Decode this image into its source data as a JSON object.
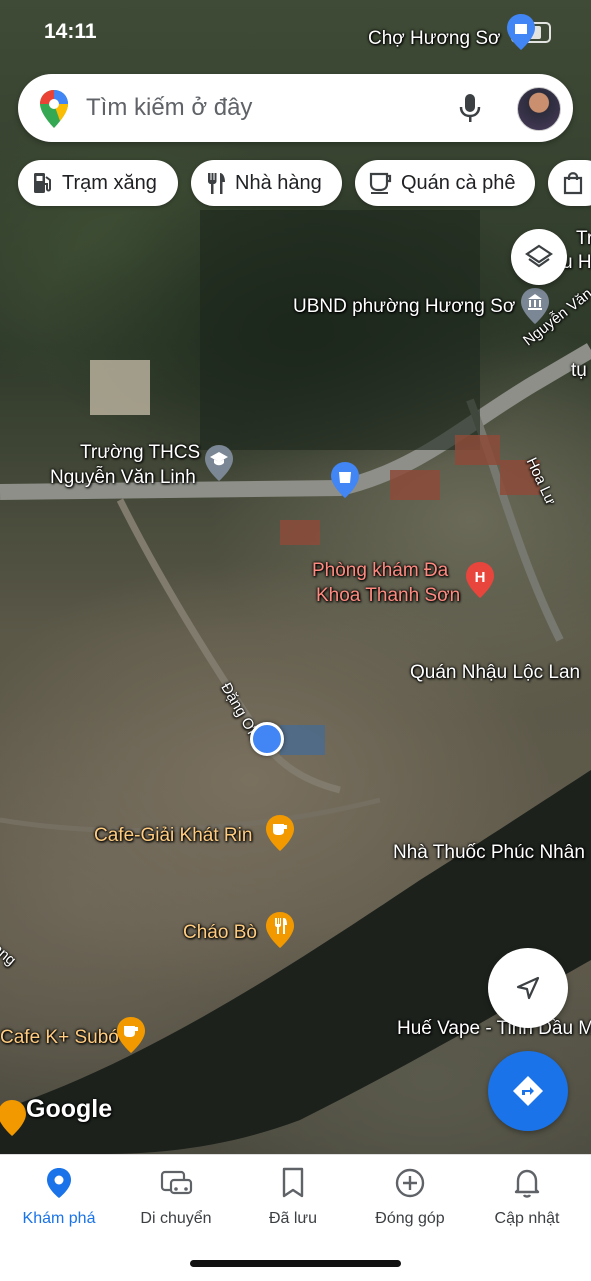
{
  "status": {
    "time": "14:11"
  },
  "search": {
    "placeholder": "Tìm kiếm ở đây"
  },
  "chips": [
    {
      "label": "Trạm xăng",
      "icon": "gas-station-icon"
    },
    {
      "label": "Nhà hàng",
      "icon": "restaurant-icon"
    },
    {
      "label": "Quán cà phê",
      "icon": "coffee-icon"
    },
    {
      "label": "",
      "icon": "shopping-bag-icon"
    }
  ],
  "map_labels": {
    "top_market": "Chợ Hương Sơ",
    "ubnd": "UBND phường Hương Sơ",
    "school_line1": "Trường THCS",
    "school_line2": "Nguyễn Văn Linh",
    "street_nguyen_van": "Nguyễn Văn",
    "street_hoa_lu": "Hoa Lư",
    "clinic_line1": "Phòng khám Đa",
    "clinic_line2": "Khoa Thanh Sơn",
    "quan_nhau": "Quán Nhậu Lộc Lan",
    "street_dang": "Đặng Ơn",
    "cafe_rin": "Cafe-Giải Khát Rin",
    "pharmacy": "Nhà Thuốc Phúc Nhân",
    "chao_bo": "Cháo Bò",
    "cafe_k": "Cafe K+ Subó",
    "hue_vape": "Huế Vape - Tinh Dầu M",
    "edge_tr": "Tr",
    "edge_uh": "u H",
    "edge_tu": "tụ",
    "edge_ang": "ang"
  },
  "google_logo": "Google",
  "nav": [
    {
      "label": "Khám phá",
      "icon": "explore-pin-icon",
      "active": true
    },
    {
      "label": "Di chuyển",
      "icon": "commute-car-icon",
      "active": false
    },
    {
      "label": "Đã lưu",
      "icon": "bookmark-icon",
      "active": false
    },
    {
      "label": "Đóng góp",
      "icon": "add-circle-icon",
      "active": false
    },
    {
      "label": "Cập nhật",
      "icon": "bell-icon",
      "active": false
    }
  ],
  "colors": {
    "accent": "#1a73e8",
    "poi_orange": "#f29900",
    "poi_red": "#e8453c",
    "poi_blue": "#4285f4"
  }
}
